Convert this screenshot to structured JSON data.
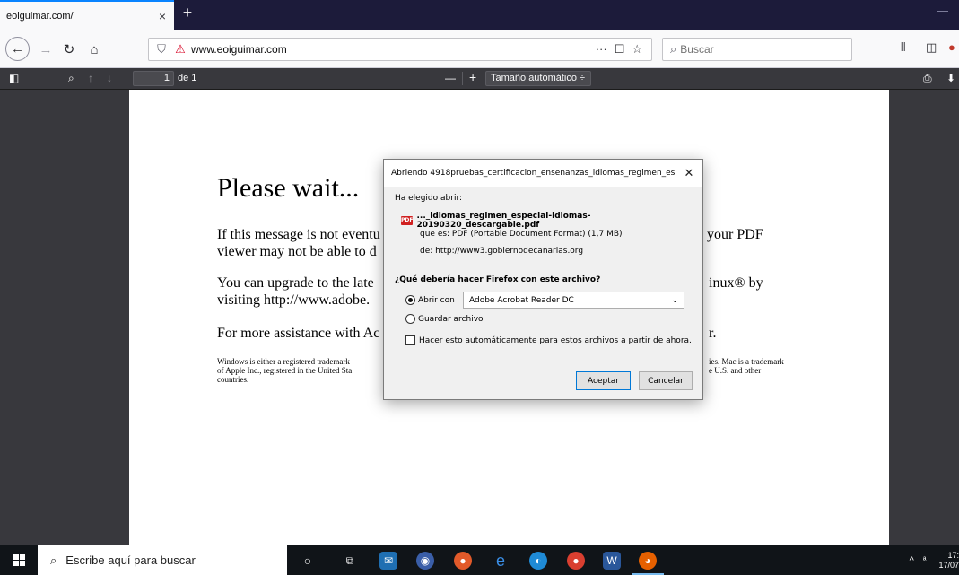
{
  "browser": {
    "tab": {
      "title": "eoiguimar.com/",
      "close_symbol": "×"
    },
    "newtab_symbol": "+",
    "url": "www.eoiguimar.com",
    "url_actions": [
      "···",
      "☐",
      "☆"
    ],
    "search_placeholder": "Buscar"
  },
  "pdf_toolbar": {
    "page_number": "1",
    "page_of": "de 1",
    "zoom_out": "—",
    "zoom_in": "+",
    "zoom_label": "Tamaño automático",
    "zoom_arrow": "÷"
  },
  "pdf": {
    "heading": "Please wait...",
    "p1_left": "If this message is not eventu",
    "p1_left2": "viewer may not be able to d",
    "p1_right": "your PDF",
    "p2_left": "You can upgrade to the late",
    "p2_left2": "visiting  http://www.adobe.",
    "p2_right": "inux® by",
    "p3_left": "For more assistance with Ac",
    "p3_right": "r.",
    "small_left1": "Windows is either a registered trademark",
    "small_left2": "of Apple Inc., registered in the United Sta",
    "small_left3": "countries.",
    "small_right1": "ies. Mac is a trademark",
    "small_right2": "e U.S. and other"
  },
  "dialog": {
    "title": "Abriendo 4918pruebas_certificacion_ensenanzas_idiomas_regimen_espe...",
    "close_symbol": "✕",
    "chosen_label": "Ha elegido abrir:",
    "filename": "..._idiomas_regimen_especial-idiomas-20190320_descargable.pdf",
    "file_icon_text": "PDF",
    "type_line": "que es:  PDF (Portable Document Format) (1,7 MB)",
    "from_line": "de:  http://www3.gobiernodecanarias.org",
    "question": "¿Qué debería hacer Firefox con este archivo?",
    "open_with_label": "Abrir con",
    "open_with_app": "Adobe Acrobat Reader DC",
    "open_with_checked": true,
    "save_label": "Guardar archivo",
    "auto_label": "Hacer esto automáticamente para estos archivos a partir de ahora.",
    "ok_label": "Aceptar",
    "cancel_label": "Cancelar"
  },
  "taskbar": {
    "search_placeholder": "Escribe aquí para buscar",
    "clock_time": "17:",
    "clock_date": "17/07",
    "ime": "ᵃ"
  },
  "colors": {
    "tabstrip": "#1c1b3a",
    "accent": "#0a84ff",
    "pdf_bg": "#38383d",
    "taskbar": "#101418"
  }
}
